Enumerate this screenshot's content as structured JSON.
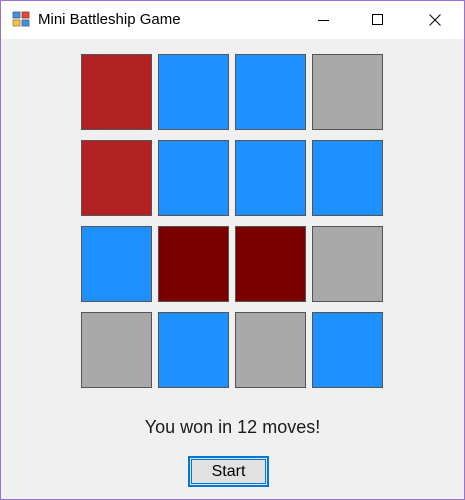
{
  "window": {
    "title": "Mini Battleship Game",
    "icon": "battleship-app-icon",
    "controls": [
      "minimize-icon",
      "maximize-icon",
      "close-icon"
    ]
  },
  "board": {
    "rows": 4,
    "cols": 4,
    "cells": [
      [
        "hit",
        "miss",
        "miss",
        "unknown"
      ],
      [
        "hit",
        "miss",
        "miss",
        "miss"
      ],
      [
        "miss",
        "sunk",
        "sunk",
        "unknown"
      ],
      [
        "unknown",
        "miss",
        "unknown",
        "miss"
      ]
    ],
    "colors": {
      "hit": "#b22222",
      "sunk": "#7a0000",
      "miss": "#1e90ff",
      "unknown": "#a9a9a9"
    }
  },
  "status_text": "You won in 12 moves!",
  "start_button_label": "Start",
  "accent_color": "#0078d7"
}
